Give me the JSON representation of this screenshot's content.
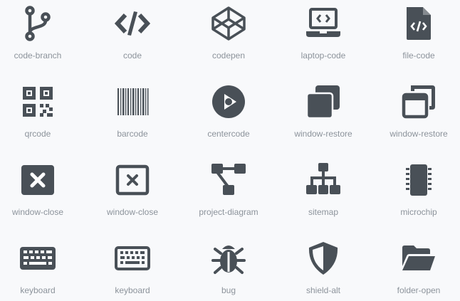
{
  "icon_color": "#495057",
  "label_color": "#8c939b",
  "background": "#f8f9fb",
  "icons": [
    {
      "name": "code-branch-icon",
      "label": "code-branch"
    },
    {
      "name": "code-icon",
      "label": "code"
    },
    {
      "name": "codepen-icon",
      "label": "codepen"
    },
    {
      "name": "laptop-code-icon",
      "label": "laptop-code"
    },
    {
      "name": "file-code-icon",
      "label": "file-code"
    },
    {
      "name": "qrcode-icon",
      "label": "qrcode"
    },
    {
      "name": "barcode-icon",
      "label": "barcode"
    },
    {
      "name": "centercode-icon",
      "label": "centercode"
    },
    {
      "name": "window-restore-solid-icon",
      "label": "window-restore"
    },
    {
      "name": "window-restore-regular-icon",
      "label": "window-restore"
    },
    {
      "name": "window-close-solid-icon",
      "label": "window-close"
    },
    {
      "name": "window-close-regular-icon",
      "label": "window-close"
    },
    {
      "name": "project-diagram-icon",
      "label": "project-diagram"
    },
    {
      "name": "sitemap-icon",
      "label": "sitemap"
    },
    {
      "name": "microchip-icon",
      "label": "microchip"
    },
    {
      "name": "keyboard-solid-icon",
      "label": "keyboard"
    },
    {
      "name": "keyboard-regular-icon",
      "label": "keyboard"
    },
    {
      "name": "bug-icon",
      "label": "bug"
    },
    {
      "name": "shield-alt-icon",
      "label": "shield-alt"
    },
    {
      "name": "folder-open-icon",
      "label": "folder-open"
    }
  ]
}
